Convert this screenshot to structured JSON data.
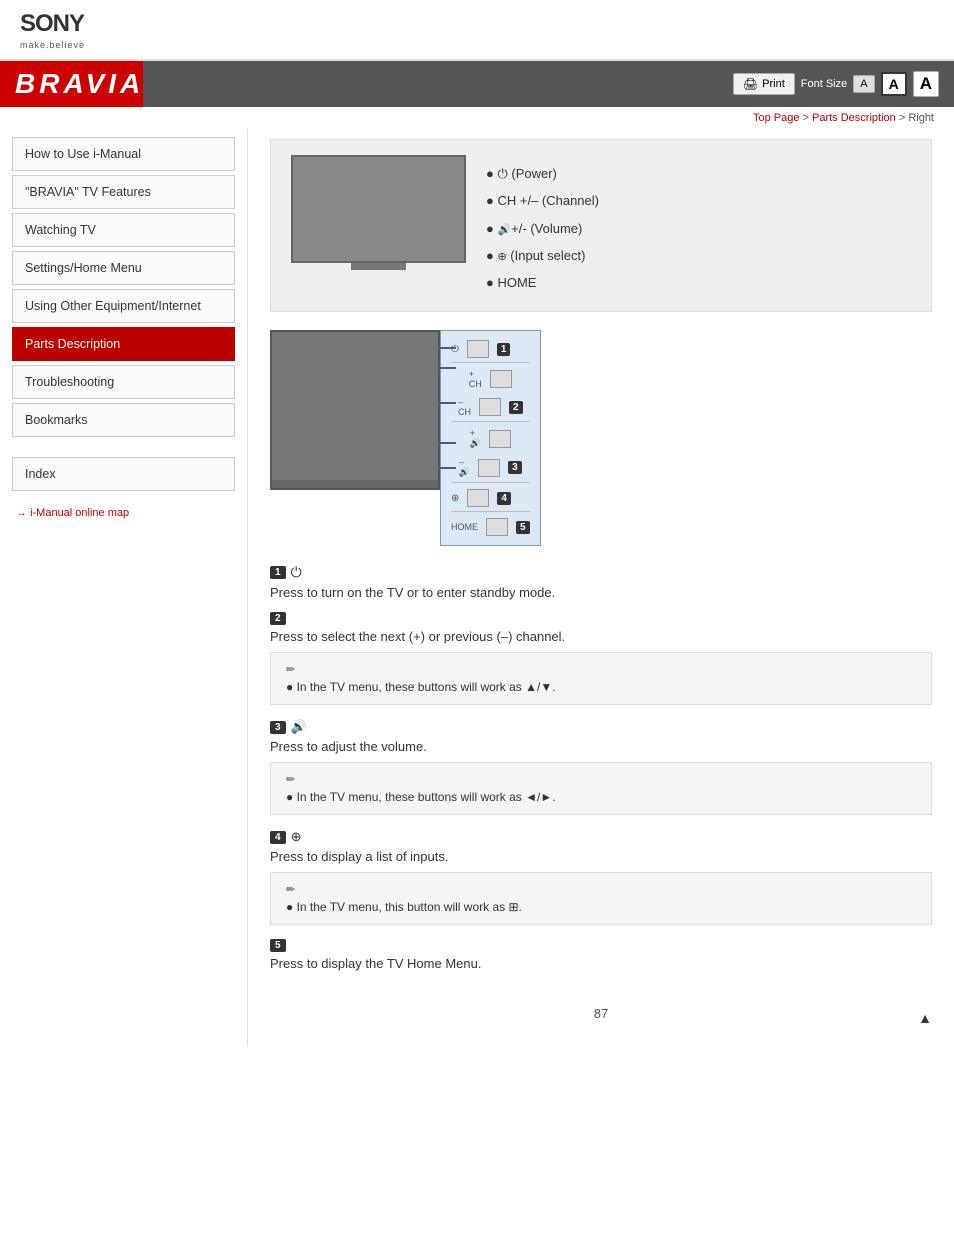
{
  "header": {
    "sony_logo": "SONY",
    "sony_tagline": "make.believe",
    "bravia_title": "BRAVIA",
    "print_label": "Print",
    "font_size_label": "Font Size",
    "font_small": "A",
    "font_medium": "A",
    "font_large": "A"
  },
  "breadcrumb": {
    "top_page": "Top Page",
    "separator1": " > ",
    "parts_desc": "Parts Description",
    "separator2": " > ",
    "current": "Right"
  },
  "sidebar": {
    "items": [
      {
        "label": "How to Use i-Manual",
        "active": false
      },
      {
        "label": "\"BRAVIA\" TV Features",
        "active": false
      },
      {
        "label": "Watching TV",
        "active": false
      },
      {
        "label": "Settings/Home Menu",
        "active": false
      },
      {
        "label": "Using Other Equipment/Internet",
        "active": false
      },
      {
        "label": "Parts Description",
        "active": true
      },
      {
        "label": "Troubleshooting",
        "active": false
      },
      {
        "label": "Bookmarks",
        "active": false
      }
    ],
    "index_label": "Index",
    "online_map_label": "i-Manual online map"
  },
  "content": {
    "tv_bullets": [
      "⏻ (Power)",
      "CH +/– (Channel)",
      "🔊 +/- (Volume)",
      "⊕ (Input select)",
      "HOME"
    ],
    "section1": {
      "number": "1",
      "icon": "⏻",
      "desc": "Press to turn on the TV or to enter standby mode."
    },
    "section2": {
      "number": "2",
      "desc": "Press to select the next (+) or previous (–) channel.",
      "note": "In the TV menu, these buttons will work as ▲/▼."
    },
    "section3": {
      "number": "3",
      "icon": "🔊",
      "desc": "Press to adjust the volume.",
      "note": "In the TV menu, these buttons will work as ◄/►."
    },
    "section4": {
      "number": "4",
      "icon": "⊕",
      "desc": "Press to display a list of inputs.",
      "note": "In the TV menu, this button will work as ⊞."
    },
    "section5": {
      "number": "5",
      "desc": "Press to display the TV Home Menu."
    },
    "page_number": "87"
  }
}
